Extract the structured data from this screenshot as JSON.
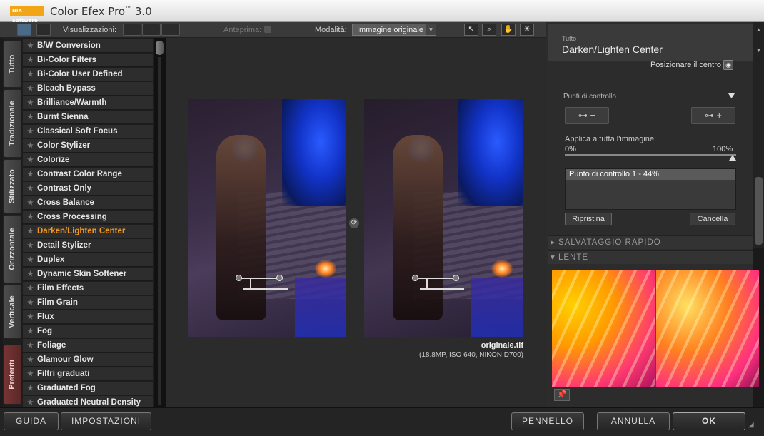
{
  "window": {
    "logo_text": "NIK Software",
    "title": "Color Efex Pro",
    "tm": "™",
    "version": " 3.0"
  },
  "toolbar": {
    "visualizzazioni": "Visualizzazioni:",
    "anteprima": "Anteprima:",
    "modalita": "Modalità:",
    "mode_value": "Immagine originale"
  },
  "tabs": [
    "Tutto",
    "Tradizionale",
    "Stilizzato",
    "Orizzontale",
    "Verticale",
    "Preferiti"
  ],
  "filters": [
    "B/W Conversion",
    "Bi-Color Filters",
    "Bi-Color User Defined",
    "Bleach Bypass",
    "Brilliance/Warmth",
    "Burnt Sienna",
    "Classical Soft Focus",
    "Color Stylizer",
    "Colorize",
    "Contrast Color Range",
    "Contrast Only",
    "Cross Balance",
    "Cross Processing",
    "Darken/Lighten Center",
    "Detail Stylizer",
    "Duplex",
    "Dynamic Skin Softener",
    "Film Effects",
    "Film Grain",
    "Flux",
    "Fog",
    "Foliage",
    "Glamour Glow",
    "Filtri graduati",
    "Graduated Fog",
    "Graduated Neutral Density"
  ],
  "selected_filter_index": 13,
  "preview": {
    "filename": "originale.tif",
    "meta": "(18.8MP, ISO 640, NIKON D700)"
  },
  "panel": {
    "category": "Tutto",
    "title": "Darken/Lighten Center",
    "position_center": "Posizionare il centro",
    "control_points": "Punti di controllo",
    "apply_all": "Applica a tutta l'immagine:",
    "pct_min": "0%",
    "pct_max": "100%",
    "apply_value_pct": 100,
    "cp_item": "Punto di controllo 1 - 44%",
    "reset": "Ripristina",
    "delete": "Cancella",
    "quick_save": "SALVATAGGIO RAPIDO",
    "lens": "LENTE"
  },
  "bottom": {
    "guide": "GUIDA",
    "settings": "IMPOSTAZIONI",
    "brush": "PENNELLO",
    "cancel": "ANNULLA",
    "ok": "OK"
  },
  "colors": {
    "accent": "#f29a1f",
    "selected": "#f29a1f"
  }
}
